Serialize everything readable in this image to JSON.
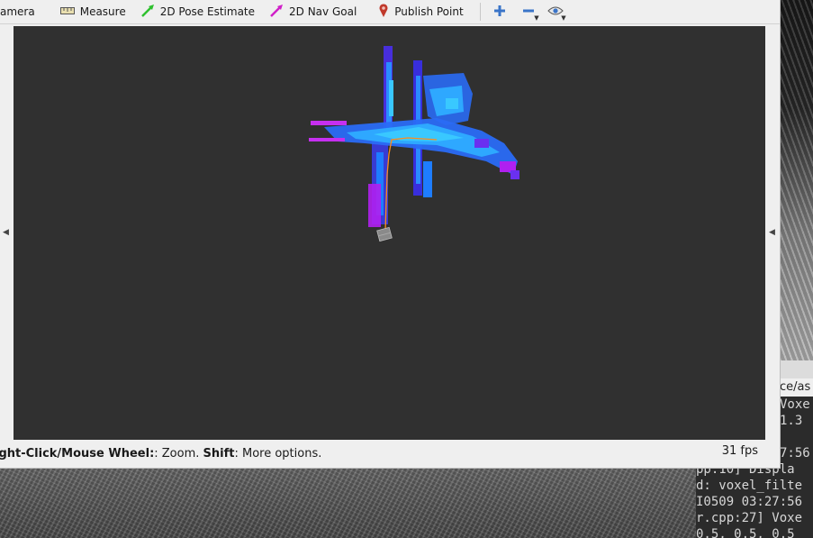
{
  "toolbar": {
    "items": [
      {
        "label": "amera",
        "icon": "camera-icon"
      },
      {
        "label": "Measure",
        "icon": "ruler-icon"
      },
      {
        "label": "2D Pose Estimate",
        "icon": "green-arrow-icon",
        "color": "#2ec02e"
      },
      {
        "label": "2D Nav Goal",
        "icon": "magenta-arrow-icon",
        "color": "#d020c8"
      },
      {
        "label": "Publish Point",
        "icon": "map-pin-icon",
        "color": "#c0392b"
      }
    ],
    "buttons": [
      {
        "icon": "plus-icon"
      },
      {
        "icon": "minus-icon"
      },
      {
        "icon": "eye-icon"
      }
    ]
  },
  "status": {
    "hint_prefix": "ight-Click/Mouse Wheel:",
    "hint_zoom": ": Zoom. ",
    "hint_shift": "Shift",
    "hint_more": ": More options.",
    "fps": "31 fps"
  },
  "terminal": {
    "path": "ce/as",
    "lines": [
      "Voxe",
      "1.3",
      "",
      "7:56",
      "pp:10] Displa",
      "d: voxel_filte",
      "I0509 03:27:56",
      "r.cpp:27] Voxe",
      "0.5, 0.5, 0.5"
    ]
  },
  "colors": {
    "viewport_bg": "#303030",
    "points_dark": "#5a1eff",
    "points_mid": "#1e7dff",
    "points_light": "#39c8ff",
    "points_edge": "#b020f0",
    "path": "#ff8c1a"
  }
}
